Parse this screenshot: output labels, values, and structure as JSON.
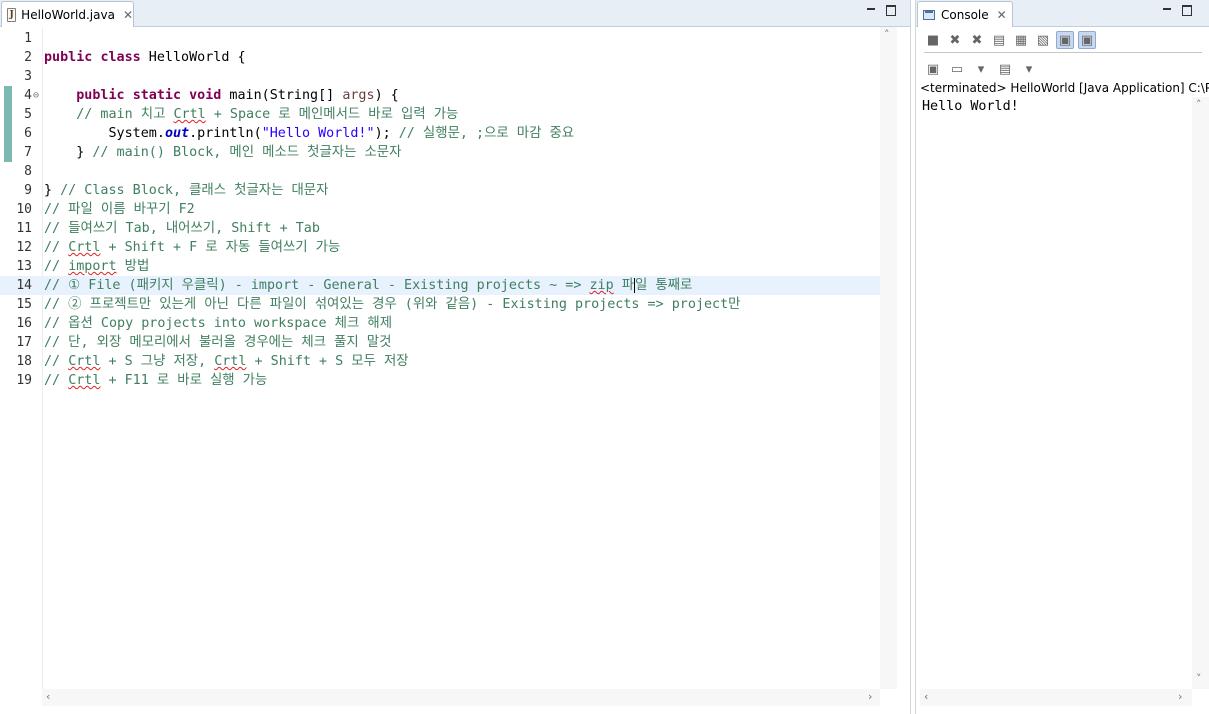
{
  "editor": {
    "tab": {
      "title": "HelloWorld.java",
      "icon": "java-file-icon",
      "close_glyph": "✕"
    },
    "change_markers": [
      4,
      5,
      6,
      7
    ],
    "fold_line": 4,
    "current_line": 14,
    "lines": [
      {
        "n": "1",
        "segs": []
      },
      {
        "n": "2",
        "segs": [
          {
            "t": "public",
            "c": "kw"
          },
          {
            "t": " "
          },
          {
            "t": "class",
            "c": "kw"
          },
          {
            "t": " HelloWorld {"
          }
        ]
      },
      {
        "n": "3",
        "segs": []
      },
      {
        "n": "4",
        "segs": [
          {
            "t": "    "
          },
          {
            "t": "public",
            "c": "kw"
          },
          {
            "t": " "
          },
          {
            "t": "static",
            "c": "kw"
          },
          {
            "t": " "
          },
          {
            "t": "void",
            "c": "kw"
          },
          {
            "t": " main(String[] "
          },
          {
            "t": "args",
            "c": "arg"
          },
          {
            "t": ") {"
          }
        ]
      },
      {
        "n": "5",
        "segs": [
          {
            "t": "    "
          },
          {
            "t": "// main 치고 ",
            "c": "cm"
          },
          {
            "t": "Crtl",
            "c": "cm sp"
          },
          {
            "t": " + Space 로 메인메서드 바로 입력 가능",
            "c": "cm"
          }
        ]
      },
      {
        "n": "6",
        "segs": [
          {
            "t": "        System."
          },
          {
            "t": "out",
            "c": "fld"
          },
          {
            "t": ".println("
          },
          {
            "t": "\"Hello World!\"",
            "c": "str"
          },
          {
            "t": "); "
          },
          {
            "t": "// 실행문, ;으로 마감 중요",
            "c": "cm"
          }
        ]
      },
      {
        "n": "7",
        "segs": [
          {
            "t": "    } "
          },
          {
            "t": "// main() Block, 메인 메소드 첫글자는 소문자",
            "c": "cm"
          }
        ]
      },
      {
        "n": "8",
        "segs": []
      },
      {
        "n": "9",
        "segs": [
          {
            "t": "} "
          },
          {
            "t": "// Class Block, 클래스 첫글자는 대문자",
            "c": "cm"
          }
        ]
      },
      {
        "n": "10",
        "segs": [
          {
            "t": "// 파일 이름 바꾸기 F2",
            "c": "cm"
          }
        ]
      },
      {
        "n": "11",
        "segs": [
          {
            "t": "// 들여쓰기 Tab, 내어쓰기, Shift + Tab",
            "c": "cm"
          }
        ]
      },
      {
        "n": "12",
        "segs": [
          {
            "t": "// ",
            "c": "cm"
          },
          {
            "t": "Crtl",
            "c": "cm sp"
          },
          {
            "t": " + Shift + F 로 자동 들여쓰기 가능",
            "c": "cm"
          }
        ]
      },
      {
        "n": "13",
        "segs": [
          {
            "t": "// ",
            "c": "cm"
          },
          {
            "t": "import",
            "c": "cm sp"
          },
          {
            "t": " 방법",
            "c": "cm"
          }
        ]
      },
      {
        "n": "14",
        "segs": [
          {
            "t": "// ① File (패키지 우클릭) - import - General - Existing projects ~ => ",
            "c": "cm"
          },
          {
            "t": "zip",
            "c": "cm sp"
          },
          {
            "t": " 파",
            "c": "cm"
          },
          {
            "t": "",
            "c": "caret"
          },
          {
            "t": "일 통째로",
            "c": "cm"
          }
        ]
      },
      {
        "n": "15",
        "segs": [
          {
            "t": "// ② 프로젝트만 있는게 아닌 다른 파일이 섞여있는 경우 (위와 같음) - Existing projects => project만",
            "c": "cm"
          }
        ]
      },
      {
        "n": "16",
        "segs": [
          {
            "t": "// 옵션 Copy projects into workspace 체크 해제",
            "c": "cm"
          }
        ]
      },
      {
        "n": "17",
        "segs": [
          {
            "t": "// 단, 외장 메모리에서 불러올 경우에는 체크 풀지 말것",
            "c": "cm"
          }
        ]
      },
      {
        "n": "18",
        "segs": [
          {
            "t": "// ",
            "c": "cm"
          },
          {
            "t": "Crtl",
            "c": "cm sp"
          },
          {
            "t": " + S 그냥 저장, ",
            "c": "cm"
          },
          {
            "t": "Crtl",
            "c": "cm sp"
          },
          {
            "t": " + Shift + S 모두 저장",
            "c": "cm"
          }
        ]
      },
      {
        "n": "19",
        "segs": [
          {
            "t": "// ",
            "c": "cm"
          },
          {
            "t": "Crtl",
            "c": "cm sp"
          },
          {
            "t": " + F11 로 바로 실행 가능",
            "c": "cm"
          }
        ]
      }
    ]
  },
  "console": {
    "tab": {
      "title": "Console",
      "icon": "console-icon",
      "close_glyph": "✕"
    },
    "toolbar": [
      {
        "name": "terminate-icon",
        "glyph": "■"
      },
      {
        "name": "remove-launch-icon",
        "glyph": "✖"
      },
      {
        "name": "remove-all-terminated-icon",
        "glyph": "✖"
      },
      {
        "name": "clear-console-icon",
        "glyph": "▤"
      },
      {
        "name": "scroll-lock-icon",
        "glyph": "▦"
      },
      {
        "name": "word-wrap-icon",
        "glyph": "▧"
      },
      {
        "name": "show-stdout-icon",
        "glyph": "▣",
        "active": true
      },
      {
        "name": "show-stderr-icon",
        "glyph": "▣",
        "active": true
      }
    ],
    "toolbar2": [
      {
        "name": "pin-console-icon",
        "glyph": "▣"
      },
      {
        "name": "display-console-icon",
        "glyph": "▭"
      },
      {
        "name": "display-dropdown-icon",
        "glyph": "▾"
      },
      {
        "name": "open-console-icon",
        "glyph": "▤"
      },
      {
        "name": "open-dropdown-icon",
        "glyph": "▾"
      }
    ],
    "status": "<terminated> HelloWorld [Java Application] C:\\Program Files\\Java",
    "output": "Hello World!"
  },
  "colors": {
    "keyword": "#7f0055",
    "comment": "#3f7f5f",
    "string": "#2a00ff",
    "current_line": "#e8f2fe",
    "change_marker": "#7cb9b0"
  }
}
